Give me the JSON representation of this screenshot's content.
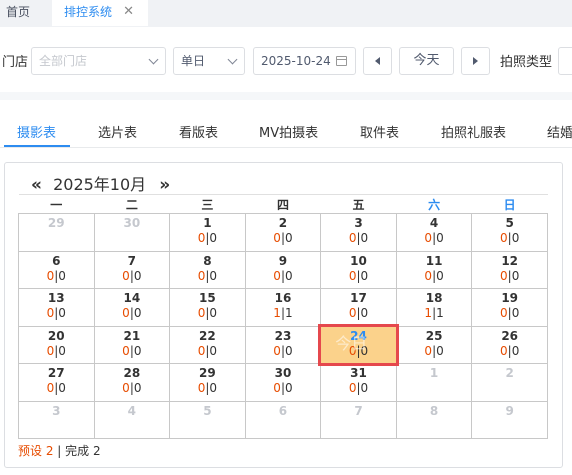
{
  "tabs": {
    "home": "首页",
    "active": "排控系统",
    "close_glyph": "✕"
  },
  "filters": {
    "store_label": "门店",
    "store_placeholder": "全部门店",
    "mode_value": "单日",
    "date_value": "2025-10-24",
    "today_button": "今天",
    "photo_type_label": "拍照类型"
  },
  "subtabs": [
    "摄影表",
    "选片表",
    "看版表",
    "MV拍摄表",
    "取件表",
    "拍照礼服表",
    "结婚"
  ],
  "calendar": {
    "prev": "«",
    "next": "»",
    "title": "2025年10月",
    "today_overlay": "今日",
    "weekdays": [
      "一",
      "二",
      "三",
      "四",
      "五",
      "六",
      "日"
    ],
    "weeks": [
      [
        {
          "d": "29",
          "out": true
        },
        {
          "d": "30",
          "out": true
        },
        {
          "d": "1",
          "a": "0",
          "b": "0"
        },
        {
          "d": "2",
          "a": "0",
          "b": "0"
        },
        {
          "d": "3",
          "a": "0",
          "b": "0"
        },
        {
          "d": "4",
          "a": "0",
          "b": "0"
        },
        {
          "d": "5",
          "a": "0",
          "b": "0"
        }
      ],
      [
        {
          "d": "6",
          "a": "0",
          "b": "0"
        },
        {
          "d": "7",
          "a": "0",
          "b": "0"
        },
        {
          "d": "8",
          "a": "0",
          "b": "0"
        },
        {
          "d": "9",
          "a": "0",
          "b": "0"
        },
        {
          "d": "10",
          "a": "0",
          "b": "0"
        },
        {
          "d": "11",
          "a": "0",
          "b": "0"
        },
        {
          "d": "12",
          "a": "0",
          "b": "0"
        }
      ],
      [
        {
          "d": "13",
          "a": "0",
          "b": "0"
        },
        {
          "d": "14",
          "a": "0",
          "b": "0"
        },
        {
          "d": "15",
          "a": "0",
          "b": "0"
        },
        {
          "d": "16",
          "a": "1",
          "b": "1"
        },
        {
          "d": "17",
          "a": "0",
          "b": "0"
        },
        {
          "d": "18",
          "a": "1",
          "b": "1"
        },
        {
          "d": "19",
          "a": "0",
          "b": "0"
        }
      ],
      [
        {
          "d": "20",
          "a": "0",
          "b": "0"
        },
        {
          "d": "21",
          "a": "0",
          "b": "0"
        },
        {
          "d": "22",
          "a": "0",
          "b": "0"
        },
        {
          "d": "23",
          "a": "0",
          "b": "0"
        },
        {
          "d": "24",
          "a": "0",
          "b": "0",
          "today": true
        },
        {
          "d": "25",
          "a": "0",
          "b": "0"
        },
        {
          "d": "26",
          "a": "0",
          "b": "0"
        }
      ],
      [
        {
          "d": "27",
          "a": "0",
          "b": "0"
        },
        {
          "d": "28",
          "a": "0",
          "b": "0"
        },
        {
          "d": "29",
          "a": "0",
          "b": "0"
        },
        {
          "d": "30",
          "a": "0",
          "b": "0"
        },
        {
          "d": "31",
          "a": "0",
          "b": "0"
        },
        {
          "d": "1",
          "out": true
        },
        {
          "d": "2",
          "out": true
        }
      ],
      [
        {
          "d": "3",
          "out": true
        },
        {
          "d": "4",
          "out": true
        },
        {
          "d": "5",
          "out": true
        },
        {
          "d": "6",
          "out": true
        },
        {
          "d": "7",
          "out": true
        },
        {
          "d": "8",
          "out": true
        },
        {
          "d": "9",
          "out": true
        }
      ]
    ],
    "separator": "|"
  },
  "legend": {
    "preset": "预设 2",
    "sep": " | ",
    "done": "完成 2"
  },
  "colors": {
    "accent": "#2d8cf0",
    "preset": "#e74c00",
    "today_fill": "#fbd28b",
    "today_border": "#e5484d"
  }
}
